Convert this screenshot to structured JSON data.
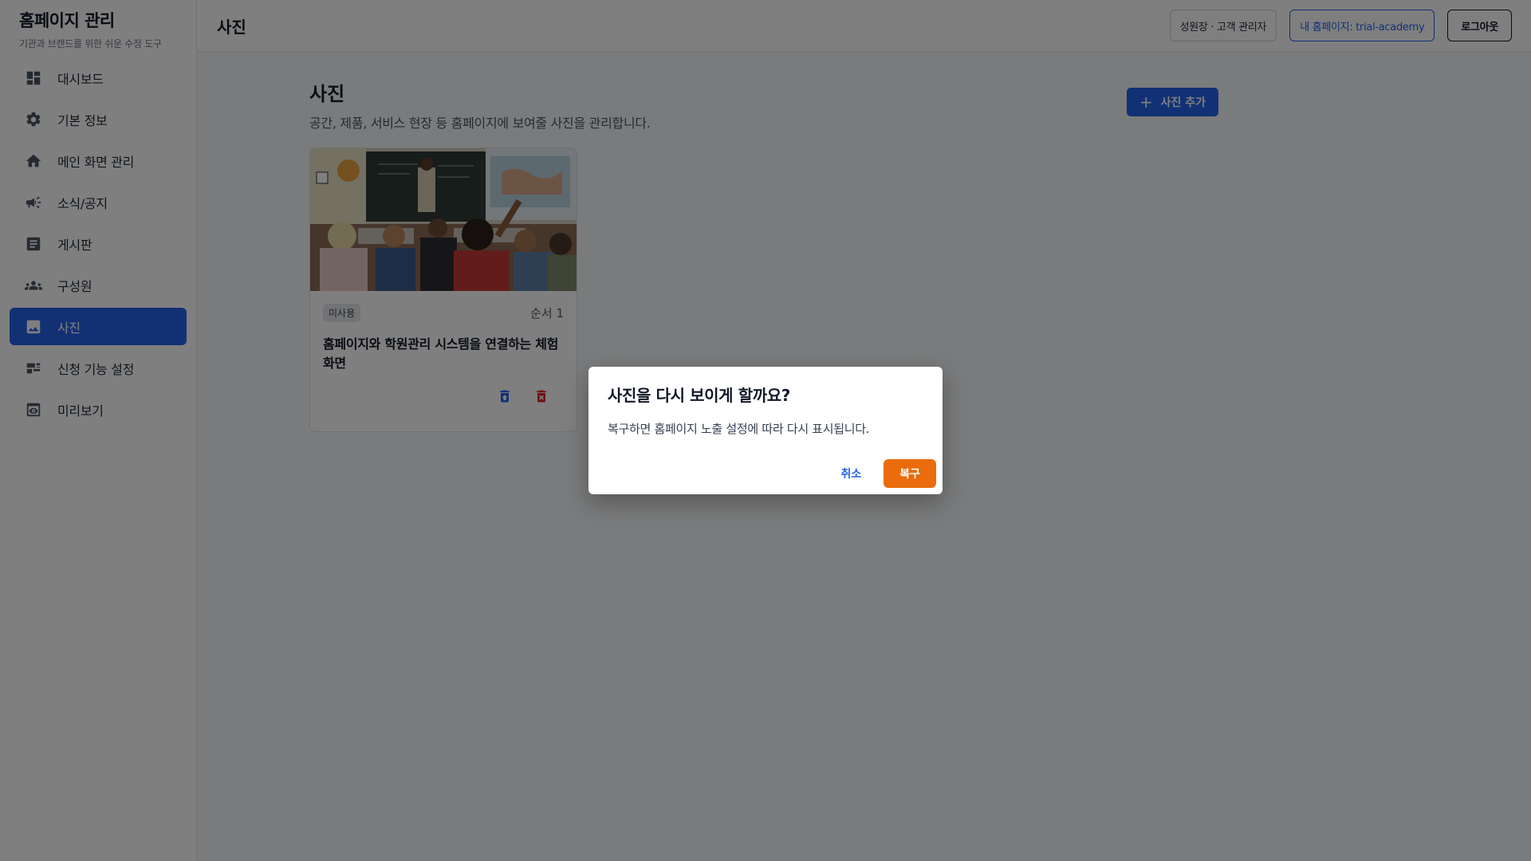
{
  "sidebar": {
    "brand_title": "홈페이지 관리",
    "brand_subtitle": "기관과 브랜드를 위한 쉬운 수정 도구",
    "items": [
      {
        "label": "대시보드",
        "icon": "dashboard-icon"
      },
      {
        "label": "기본 정보",
        "icon": "gear-icon"
      },
      {
        "label": "메인 화면 관리",
        "icon": "home-icon"
      },
      {
        "label": "소식/공지",
        "icon": "megaphone-icon"
      },
      {
        "label": "게시판",
        "icon": "article-icon"
      },
      {
        "label": "구성원",
        "icon": "people-icon"
      },
      {
        "label": "사진",
        "icon": "image-icon",
        "active": true
      },
      {
        "label": "신청 기능 설정",
        "icon": "form-icon"
      },
      {
        "label": "미리보기",
        "icon": "preview-icon"
      }
    ]
  },
  "topbar": {
    "title": "사진",
    "role_label": "성원장 · 고객 관리자",
    "homepage_label": "내 홈페이지: trial-academy",
    "logout_label": "로그아웃"
  },
  "page": {
    "title": "사진",
    "description": "공간, 제품, 서비스 현장 등 홈페이지에 보여줄 사진을 관리합니다.",
    "add_button": "사진 추가"
  },
  "photos": [
    {
      "status": "미사용",
      "order": "순서 1",
      "title": "홈페이지와 학원관리 시스템을 연결하는 체험 화면"
    }
  ],
  "dialog": {
    "title": "사진을 다시 보이게 할까요?",
    "message": "복구하면 홈페이지 노출 설정에 따라 다시 표시됩니다.",
    "cancel_label": "취소",
    "confirm_label": "복구"
  },
  "colors": {
    "primary": "#2563eb",
    "restore": "#ea6c0c",
    "danger": "#dc2626"
  }
}
